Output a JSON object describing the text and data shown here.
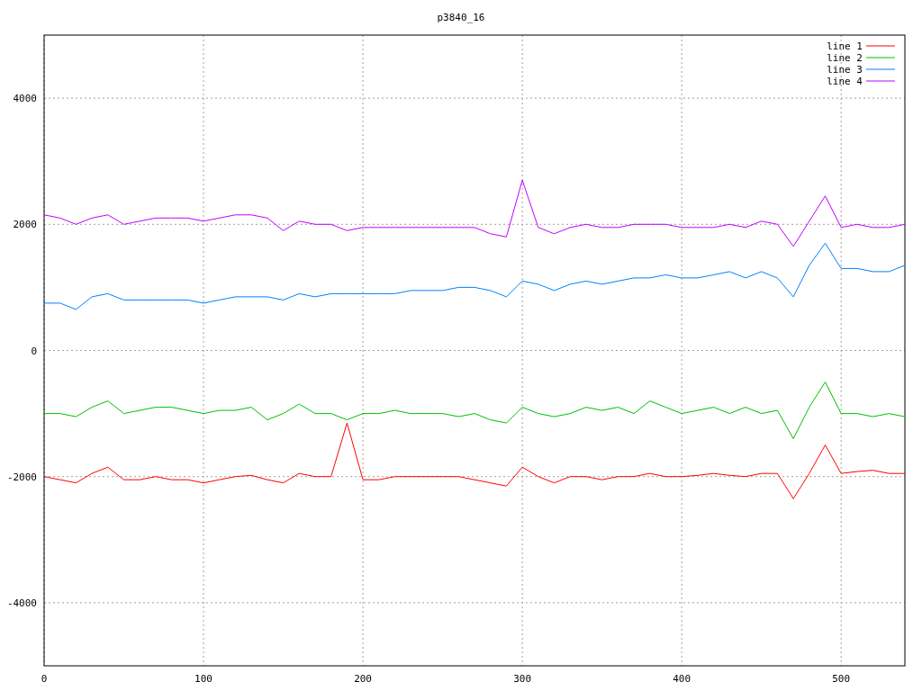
{
  "chart_data": {
    "type": "line",
    "title": "p3840_16",
    "grid": true,
    "legend": true,
    "xlim": [
      0,
      540
    ],
    "ylim": [
      -5000,
      5000
    ],
    "xticks": [
      0,
      100,
      200,
      300,
      400,
      500
    ],
    "yticks": [
      {
        "value": -4000,
        "label": "-4000"
      },
      {
        "value": -2000,
        "label": "-2000"
      },
      {
        "value": 0,
        "label": "0"
      },
      {
        "value": 2000,
        "label": "2000"
      },
      {
        "value": 4000,
        "label": "4000"
      }
    ],
    "x": [
      0,
      10,
      20,
      30,
      40,
      50,
      60,
      70,
      80,
      90,
      100,
      110,
      120,
      130,
      140,
      150,
      160,
      170,
      180,
      190,
      200,
      210,
      220,
      230,
      240,
      250,
      260,
      270,
      280,
      290,
      300,
      310,
      320,
      330,
      340,
      350,
      360,
      370,
      380,
      390,
      400,
      410,
      420,
      430,
      440,
      450,
      460,
      470,
      480,
      490,
      500,
      510,
      520,
      530,
      540
    ],
    "series": [
      {
        "name": "line 1",
        "color": "#ff0000",
        "values": [
          -2000,
          -2050,
          -2100,
          -1950,
          -1850,
          -2050,
          -2050,
          -2000,
          -2050,
          -2050,
          -2100,
          -2050,
          -2000,
          -1980,
          -2050,
          -2100,
          -1950,
          -2000,
          -2000,
          -1150,
          -2050,
          -2050,
          -2000,
          -2000,
          -2000,
          -2000,
          -2000,
          -2050,
          -2100,
          -2150,
          -1850,
          -2000,
          -2100,
          -2000,
          -2000,
          -2050,
          -2000,
          -2000,
          -1950,
          -2000,
          -2000,
          -1980,
          -1950,
          -1980,
          -2000,
          -1950,
          -1950,
          -2350,
          -1950,
          -1500,
          -1950,
          -1920,
          -1900,
          -1950,
          -1950
        ]
      },
      {
        "name": "line 2",
        "color": "#00c000",
        "values": [
          -1000,
          -1000,
          -1050,
          -900,
          -800,
          -1000,
          -950,
          -900,
          -900,
          -950,
          -1000,
          -950,
          -950,
          -900,
          -1100,
          -1000,
          -850,
          -1000,
          -1000,
          -1100,
          -1000,
          -1000,
          -950,
          -1000,
          -1000,
          -1000,
          -1050,
          -1000,
          -1100,
          -1150,
          -900,
          -1000,
          -1050,
          -1000,
          -900,
          -950,
          -900,
          -1000,
          -800,
          -900,
          -1000,
          -950,
          -900,
          -1000,
          -900,
          -1000,
          -950,
          -1400,
          -900,
          -500,
          -1000,
          -1000,
          -1050,
          -1000,
          -1050
        ]
      },
      {
        "name": "line 3",
        "color": "#0080ff",
        "values": [
          750,
          750,
          650,
          850,
          900,
          800,
          800,
          800,
          800,
          800,
          750,
          800,
          850,
          850,
          850,
          800,
          900,
          850,
          900,
          900,
          900,
          900,
          900,
          950,
          950,
          950,
          1000,
          1000,
          950,
          850,
          1100,
          1050,
          950,
          1050,
          1100,
          1050,
          1100,
          1150,
          1150,
          1200,
          1150,
          1150,
          1200,
          1250,
          1150,
          1250,
          1150,
          850,
          1350,
          1700,
          1300,
          1300,
          1250,
          1250,
          1350
        ]
      },
      {
        "name": "line 4",
        "color": "#c000ff",
        "values": [
          2150,
          2100,
          2000,
          2100,
          2150,
          2000,
          2050,
          2100,
          2100,
          2100,
          2050,
          2100,
          2150,
          2150,
          2100,
          1900,
          2050,
          2000,
          2000,
          1900,
          1950,
          1950,
          1950,
          1950,
          1950,
          1950,
          1950,
          1950,
          1850,
          1800,
          2700,
          1950,
          1850,
          1950,
          2000,
          1950,
          1950,
          2000,
          2000,
          2000,
          1950,
          1950,
          1950,
          2000,
          1950,
          2050,
          2000,
          1650,
          2050,
          2450,
          1950,
          2000,
          1950,
          1950,
          2000
        ]
      }
    ]
  }
}
